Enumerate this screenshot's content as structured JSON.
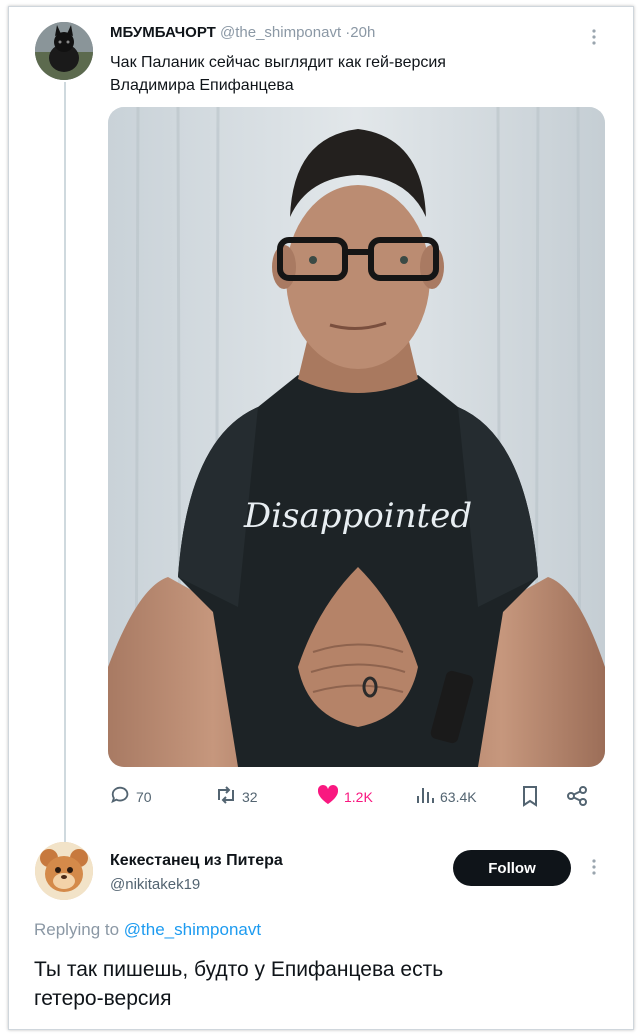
{
  "tweet": {
    "display_name": "МБУМБАЧОРТ",
    "handle": "@the_shimponavt",
    "dot": "·",
    "time": "20h",
    "text_line1": "Чак Паланик сейчас выглядит как гей-версия",
    "text_line2": "Владимира Епифанцева",
    "shirt_text": "Disappointed",
    "stats": {
      "replies": "70",
      "retweets": "32",
      "likes": "1.2K",
      "views": "63.4K"
    }
  },
  "reply": {
    "display_name": "Кекестанец из Питера",
    "handle": "@nikitakek19",
    "follow_label": "Follow",
    "replying_prefix": "Replying to",
    "replying_mention": "@the_shimponavt",
    "text_line1": "Ты так пишешь, будто у Епифанцева есть",
    "text_line2": "гетеро-версия"
  },
  "colors": {
    "accent": "#1d9bf0",
    "like": "#f91880",
    "muted": "#536471"
  },
  "icons": [
    "reply-icon",
    "retweet-icon",
    "heart-icon",
    "views-icon",
    "bookmark-icon",
    "share-icon",
    "more-icon"
  ]
}
